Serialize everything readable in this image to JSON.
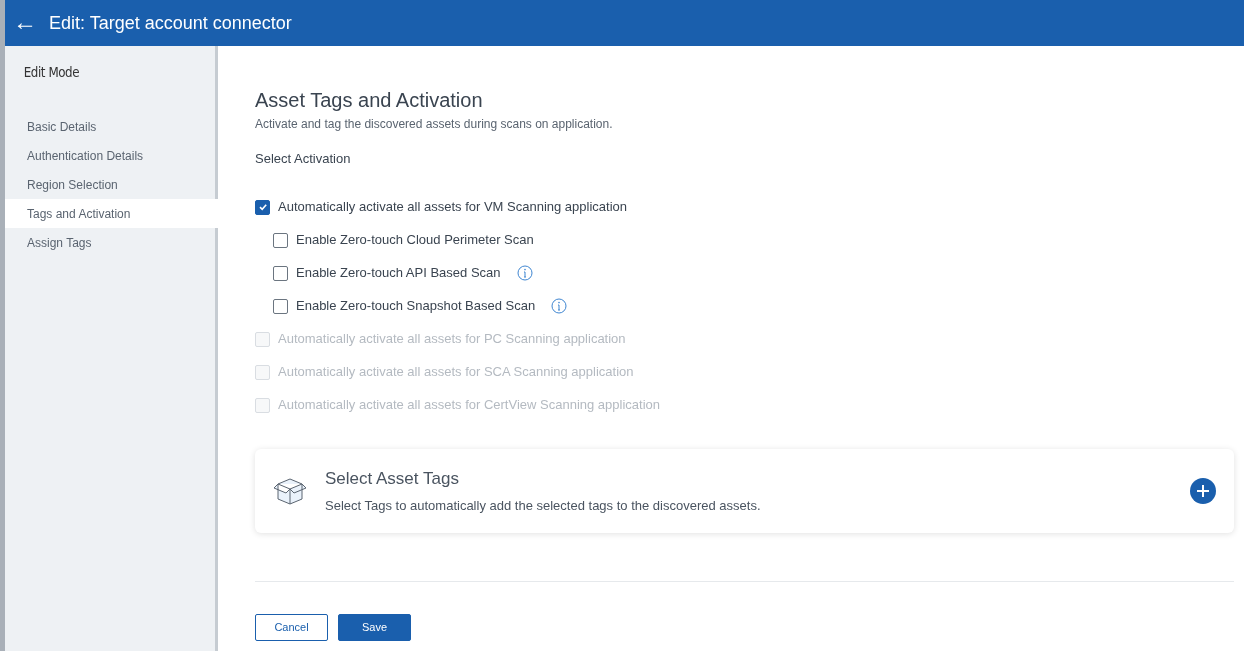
{
  "header": {
    "back_glyph": "←",
    "title": "Edit: Target account connector"
  },
  "sidebar": {
    "heading": "Edit Mode",
    "items": [
      {
        "label": "Basic Details",
        "selected": false
      },
      {
        "label": "Authentication Details",
        "selected": false
      },
      {
        "label": "Region Selection",
        "selected": false
      },
      {
        "label": "Tags and Activation",
        "selected": true
      },
      {
        "label": "Assign Tags",
        "selected": false
      }
    ]
  },
  "section": {
    "title": "Asset Tags and Activation",
    "subtitle": "Activate and tag the discovered assets during scans on application.",
    "label": "Select Activation"
  },
  "options": [
    {
      "label": "Automatically activate all assets for VM Scanning application",
      "checked": true,
      "disabled": false,
      "info": false,
      "children": [
        {
          "label": "Enable Zero-touch Cloud Perimeter Scan",
          "checked": false,
          "disabled": false,
          "info": false
        },
        {
          "label": "Enable Zero-touch API Based Scan",
          "checked": false,
          "disabled": false,
          "info": true
        },
        {
          "label": "Enable Zero-touch Snapshot Based Scan",
          "checked": false,
          "disabled": false,
          "info": true
        }
      ]
    },
    {
      "label": "Automatically activate all assets for PC Scanning application",
      "checked": false,
      "disabled": true,
      "info": false
    },
    {
      "label": "Automatically activate all assets for SCA Scanning application",
      "checked": false,
      "disabled": true,
      "info": false
    },
    {
      "label": "Automatically activate all assets for CertView Scanning application",
      "checked": false,
      "disabled": true,
      "info": false
    }
  ],
  "tags_card": {
    "title": "Select Asset Tags",
    "description": "Select Tags to automatically add the selected tags to the discovered assets."
  },
  "buttons": [
    {
      "label": "Cancel",
      "kind": "secondary"
    },
    {
      "label": "Save",
      "kind": "primary"
    }
  ]
}
